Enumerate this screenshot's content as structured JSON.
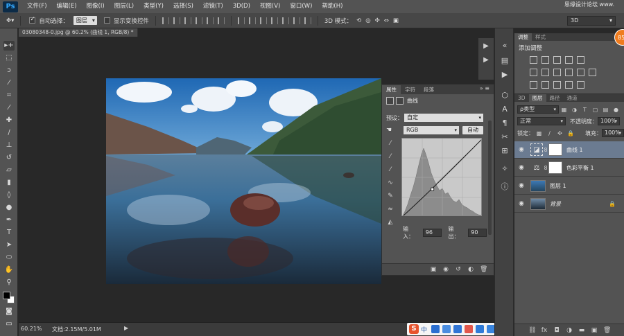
{
  "app": {
    "logo": "Ps"
  },
  "menu": [
    "文件(F)",
    "编辑(E)",
    "图像(I)",
    "图层(L)",
    "类型(Y)",
    "选择(S)",
    "滤镜(T)",
    "3D(D)",
    "视图(V)",
    "窗口(W)",
    "帮助(H)"
  ],
  "watermark": "思缘设计论坛 www.",
  "options": {
    "auto_select_label": "自动选择：",
    "auto_select_value": "图层",
    "show_transform_label": "显示变换控件",
    "mode3d_label": "3D 模式：",
    "workspace": "3D"
  },
  "document": {
    "tab_title": "03080348-0.jpg @ 60.2% (曲线 1, RGB/8) *"
  },
  "status": {
    "zoom": "60.21%",
    "doc_size": "文档:2.15M/5.01M",
    "arrow": "▶"
  },
  "ime": {
    "logo": "S",
    "lang": "中"
  },
  "properties": {
    "tabs": [
      "属性",
      "字符",
      "段落"
    ],
    "title": "曲线",
    "preset_label": "预设：",
    "preset_value": "自定",
    "channel_value": "RGB",
    "auto_label": "自动",
    "input_label": "输入：",
    "input_value": "96",
    "output_label": "输出：",
    "output_value": "90",
    "curve_point": {
      "input": 96,
      "output": 90
    }
  },
  "adjustments": {
    "tabs": [
      "调整",
      "样式"
    ],
    "title": "添加调整"
  },
  "badge": "85",
  "layers": {
    "tabs": [
      "3D",
      "图层",
      "路径",
      "通道"
    ],
    "filter_kind": "ρ类型",
    "blend_mode": "正常",
    "opacity_label": "不透明度：",
    "opacity_value": "100%",
    "lock_label": "锁定：",
    "fill_label": "填充：",
    "fill_value": "100%",
    "items": [
      {
        "name": "曲线 1",
        "type": "curves",
        "selected": true
      },
      {
        "name": "色彩平衡 1",
        "type": "color-balance",
        "selected": false
      },
      {
        "name": "图层 1",
        "type": "image",
        "selected": false
      },
      {
        "name": "背景",
        "type": "background",
        "selected": false
      }
    ]
  },
  "colors": {
    "accent_selection": "#6b7b91",
    "panel": "#535353",
    "badge": "#f07c1e"
  }
}
